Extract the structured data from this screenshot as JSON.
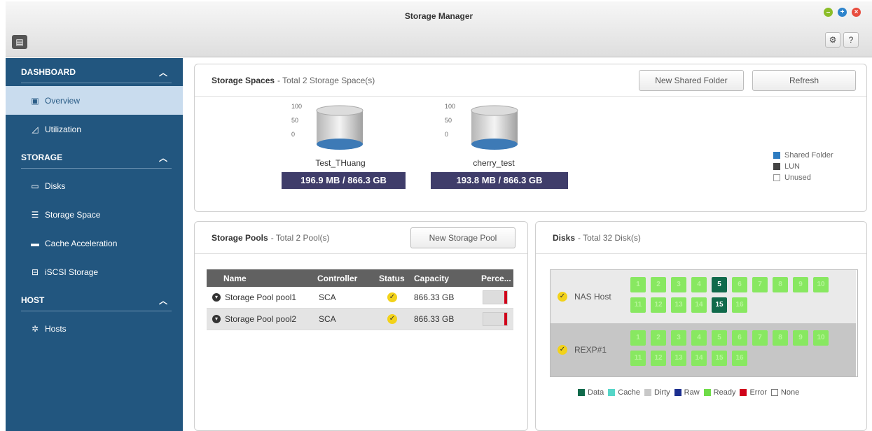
{
  "window": {
    "title": "Storage Manager",
    "controls": [
      "minimize",
      "maximize",
      "close"
    ],
    "toolbar": {
      "settings_icon": "gear-icon",
      "help_label": "?"
    }
  },
  "sidebar": {
    "sections": [
      {
        "title": "DASHBOARD",
        "items": [
          {
            "label": "Overview",
            "icon": "overview-icon",
            "active": true
          },
          {
            "label": "Utilization",
            "icon": "chart-icon",
            "active": false
          }
        ]
      },
      {
        "title": "STORAGE",
        "items": [
          {
            "label": "Disks",
            "icon": "disk-icon",
            "active": false
          },
          {
            "label": "Storage Space",
            "icon": "list-icon",
            "active": false
          },
          {
            "label": "Cache Acceleration",
            "icon": "cache-icon",
            "active": false
          },
          {
            "label": "iSCSI Storage",
            "icon": "iscsi-icon",
            "active": false
          }
        ]
      },
      {
        "title": "HOST",
        "items": [
          {
            "label": "Hosts",
            "icon": "gear-icon",
            "active": false
          }
        ]
      }
    ]
  },
  "storage_spaces": {
    "title": "Storage Spaces",
    "subtitle": "- Total 2 Storage Space(s)",
    "buttons": {
      "new_shared_folder": "New Shared Folder",
      "refresh": "Refresh"
    },
    "axis_ticks": [
      "100",
      "50",
      "0"
    ],
    "spaces": [
      {
        "name": "Test_THuang",
        "capacity": "196.9 MB / 866.3 GB"
      },
      {
        "name": "cherry_test",
        "capacity": "193.8 MB / 866.3 GB"
      }
    ],
    "legend": [
      {
        "label": "Shared Folder",
        "color": "#2e7cc1"
      },
      {
        "label": "LUN",
        "color": "#444444"
      },
      {
        "label": "Unused",
        "color": "#ffffff"
      }
    ]
  },
  "storage_pools": {
    "title": "Storage Pools",
    "subtitle": "- Total 2 Pool(s)",
    "new_button": "New Storage Pool",
    "columns": [
      "Name",
      "Controller",
      "Status",
      "Capacity",
      "Perce..."
    ],
    "rows": [
      {
        "name": "Storage Pool pool1",
        "controller": "SCA",
        "capacity": "866.33 GB",
        "percent": 0.1
      },
      {
        "name": "Storage Pool pool2",
        "controller": "SCA",
        "capacity": "866.33 GB",
        "percent": 0.1
      }
    ]
  },
  "disks": {
    "title": "Disks",
    "subtitle": "- Total 32 Disk(s)",
    "hosts": [
      {
        "name": "NAS Host",
        "disks": [
          {
            "n": "1",
            "s": "ready"
          },
          {
            "n": "2",
            "s": "ready"
          },
          {
            "n": "3",
            "s": "ready"
          },
          {
            "n": "4",
            "s": "ready"
          },
          {
            "n": "5",
            "s": "data"
          },
          {
            "n": "6",
            "s": "ready"
          },
          {
            "n": "7",
            "s": "ready"
          },
          {
            "n": "8",
            "s": "ready"
          },
          {
            "n": "9",
            "s": "ready"
          },
          {
            "n": "10",
            "s": "ready"
          },
          {
            "n": "11",
            "s": "ready"
          },
          {
            "n": "12",
            "s": "ready"
          },
          {
            "n": "13",
            "s": "ready"
          },
          {
            "n": "14",
            "s": "ready"
          },
          {
            "n": "15",
            "s": "data"
          },
          {
            "n": "16",
            "s": "ready"
          }
        ]
      },
      {
        "name": "REXP#1",
        "disks": [
          {
            "n": "1",
            "s": "ready"
          },
          {
            "n": "2",
            "s": "ready"
          },
          {
            "n": "3",
            "s": "ready"
          },
          {
            "n": "4",
            "s": "ready"
          },
          {
            "n": "5",
            "s": "ready"
          },
          {
            "n": "6",
            "s": "ready"
          },
          {
            "n": "7",
            "s": "ready"
          },
          {
            "n": "8",
            "s": "ready"
          },
          {
            "n": "9",
            "s": "ready"
          },
          {
            "n": "10",
            "s": "ready"
          },
          {
            "n": "11",
            "s": "ready"
          },
          {
            "n": "12",
            "s": "ready"
          },
          {
            "n": "13",
            "s": "ready"
          },
          {
            "n": "14",
            "s": "ready"
          },
          {
            "n": "15",
            "s": "ready"
          },
          {
            "n": "16",
            "s": "ready"
          }
        ]
      }
    ],
    "legend": [
      {
        "label": "Data",
        "color": "#106a4b"
      },
      {
        "label": "Cache",
        "color": "#56d6c8"
      },
      {
        "label": "Dirty",
        "color": "#c8c8c8"
      },
      {
        "label": "Raw",
        "color": "#1c2f8f"
      },
      {
        "label": "Ready",
        "color": "#6fdc48"
      },
      {
        "label": "Error",
        "color": "#d0021b"
      },
      {
        "label": "None",
        "color": "#ffffff"
      }
    ]
  }
}
